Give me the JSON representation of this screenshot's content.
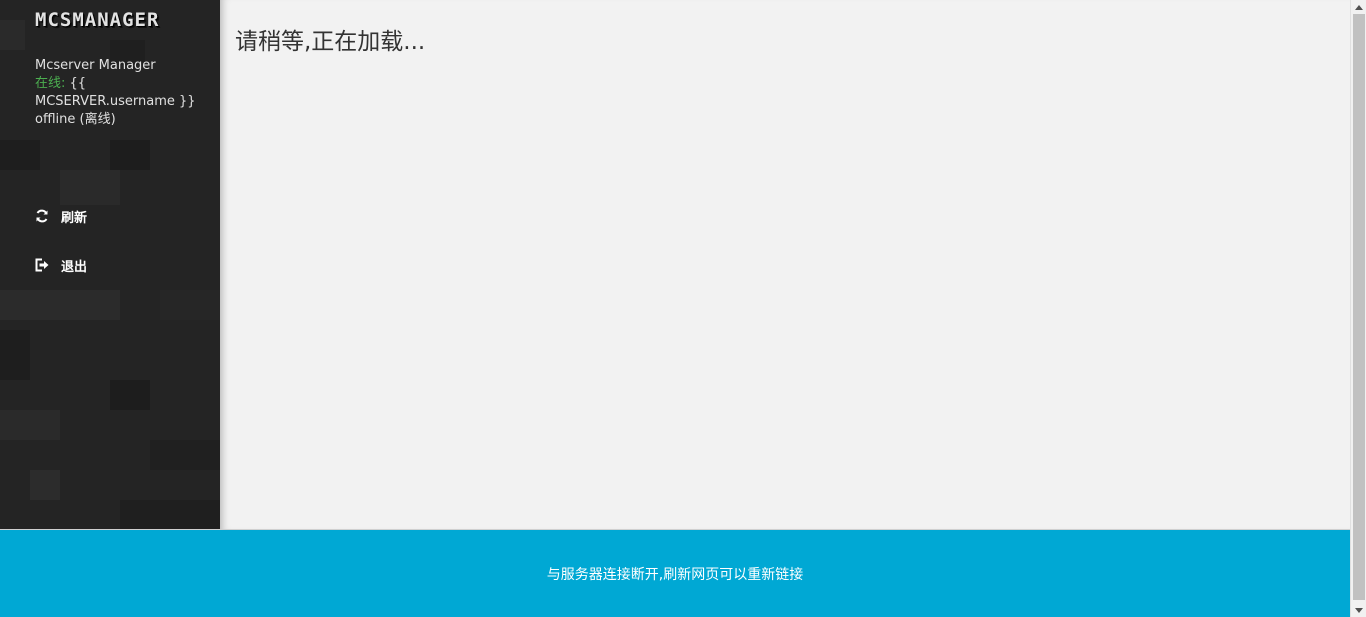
{
  "sidebar": {
    "logo": "MCSMANAGER",
    "app_name": "Mcserver Manager",
    "online_label": "在线:",
    "username_placeholder": "{{ MCSERVER.username }}",
    "status": "offline (离线)",
    "nav": [
      {
        "label": "刷新",
        "icon": "refresh-icon"
      },
      {
        "label": "退出",
        "icon": "logout-icon"
      }
    ]
  },
  "main": {
    "loading_text": "请稍等,正在加载..."
  },
  "banner": {
    "message": "与服务器连接断开,刷新网页可以重新链接",
    "color": "#00a8d4"
  },
  "colors": {
    "sidebar_bg": "#242424",
    "online_green": "#4caf50",
    "main_bg": "#f2f2f2"
  }
}
